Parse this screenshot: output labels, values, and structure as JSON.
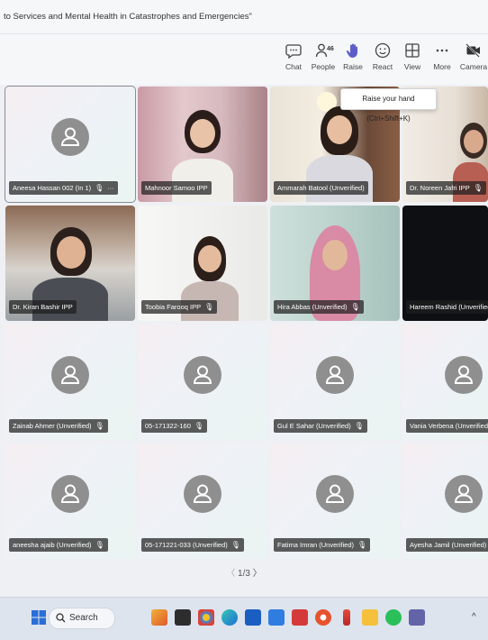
{
  "window": {
    "title": "to Services and Mental Health in Catastrophes and Emergencies\""
  },
  "toolbar": {
    "chat": "Chat",
    "people": "People",
    "people_count": "46",
    "raise": "Raise",
    "react": "React",
    "view": "View",
    "more": "More",
    "camera": "Camera"
  },
  "tooltip": "Raise your hand (Ctrl+Shift+K)",
  "participants": [
    {
      "name": "Aneesa Hassan 002 (In 1)",
      "type": "avatar"
    },
    {
      "name": "Mahnoor Samoo IPP",
      "type": "video"
    },
    {
      "name": "Ammarah Batool (Unverified)",
      "type": "video"
    },
    {
      "name": "Dr. Noreen Jafri IPP",
      "type": "video"
    },
    {
      "name": "Dr. Kiran Bashir IPP",
      "type": "video"
    },
    {
      "name": "Toobia Farooq IPP",
      "type": "video"
    },
    {
      "name": "Hira Abbas (Unverified)",
      "type": "video"
    },
    {
      "name": "Hareem Rashid (Unverified)",
      "type": "video"
    },
    {
      "name": "Zainab Ahmer (Unverified)",
      "type": "avatar"
    },
    {
      "name": "05-171322-160",
      "type": "avatar"
    },
    {
      "name": "Gul E Sahar (Unverified)",
      "type": "avatar"
    },
    {
      "name": "Vania Verbena (Unverified)",
      "type": "avatar"
    },
    {
      "name": "aneesha ajaib (Unverified)",
      "type": "avatar"
    },
    {
      "name": "05-171221-033 (Unverified)",
      "type": "avatar"
    },
    {
      "name": "Fatima Imran (Unverified)",
      "type": "avatar"
    },
    {
      "name": "Ayesha Jamil (Unverified)",
      "type": "avatar"
    }
  ],
  "pager": {
    "prev": "〈",
    "label": "1/3",
    "next": "〉"
  },
  "taskbar": {
    "search": "Search",
    "start_color": "#2b6fd6",
    "accent_color": "#6264a7"
  }
}
